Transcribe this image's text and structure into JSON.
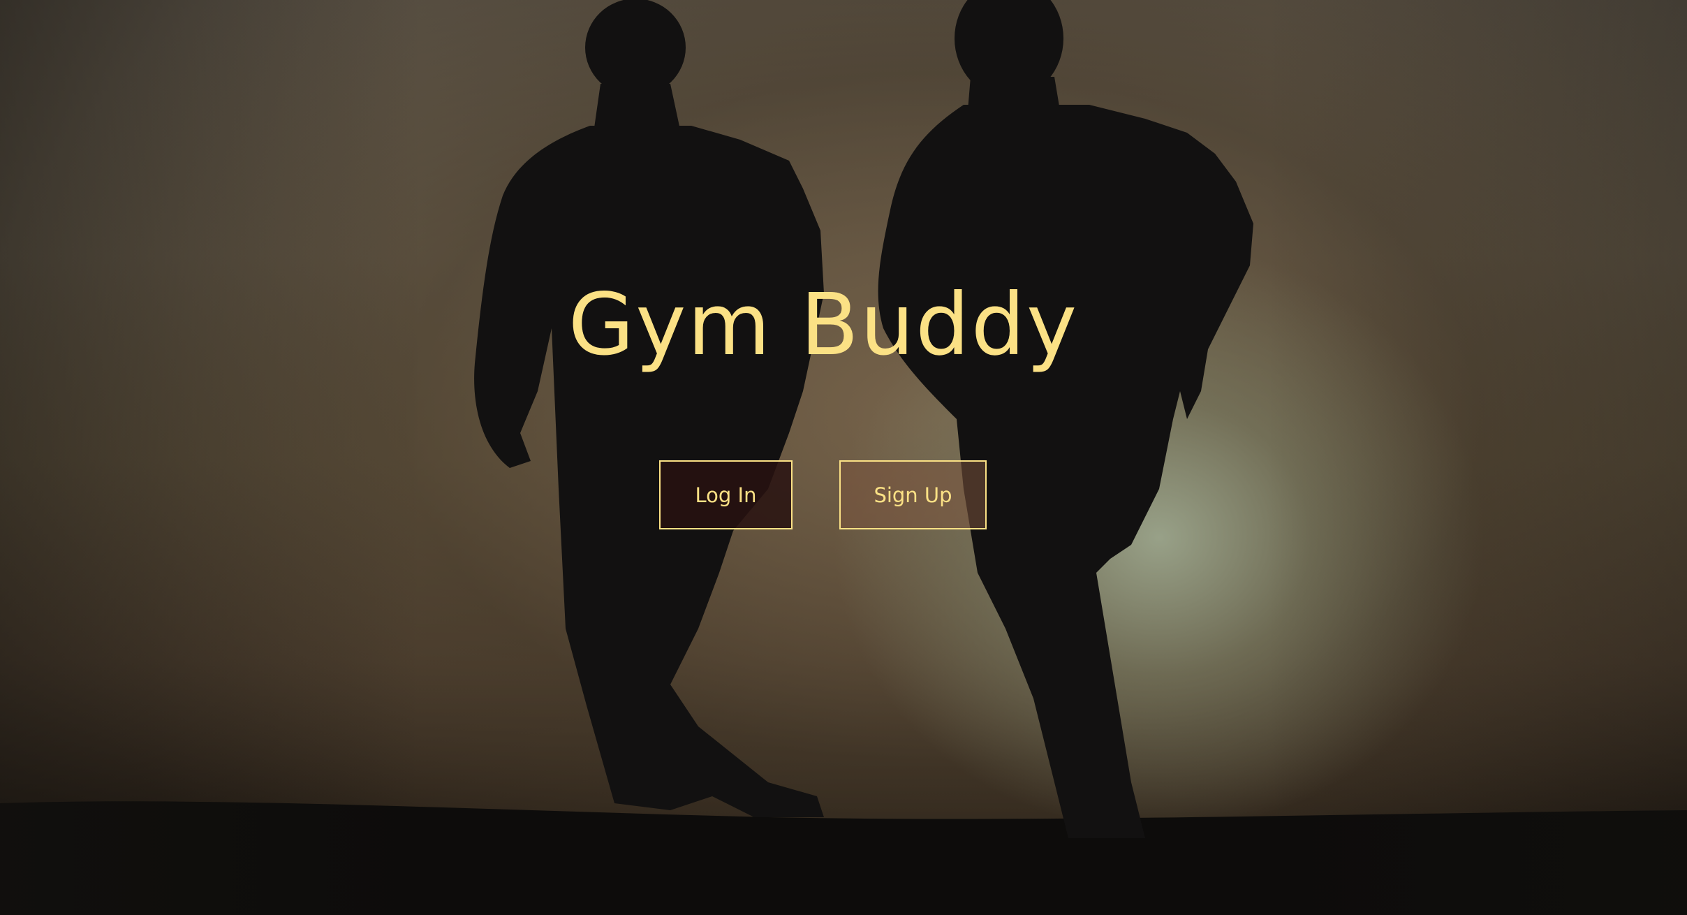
{
  "app": {
    "title": "Gym Buddy"
  },
  "actions": {
    "login_label": "Log In",
    "signup_label": "Sign Up"
  },
  "colors": {
    "accent": "#fbe185",
    "login_bg": "#281210",
    "signup_bg": "#78523c"
  },
  "background": {
    "image_subject": "two-runners-silhouette-at-sunset"
  }
}
